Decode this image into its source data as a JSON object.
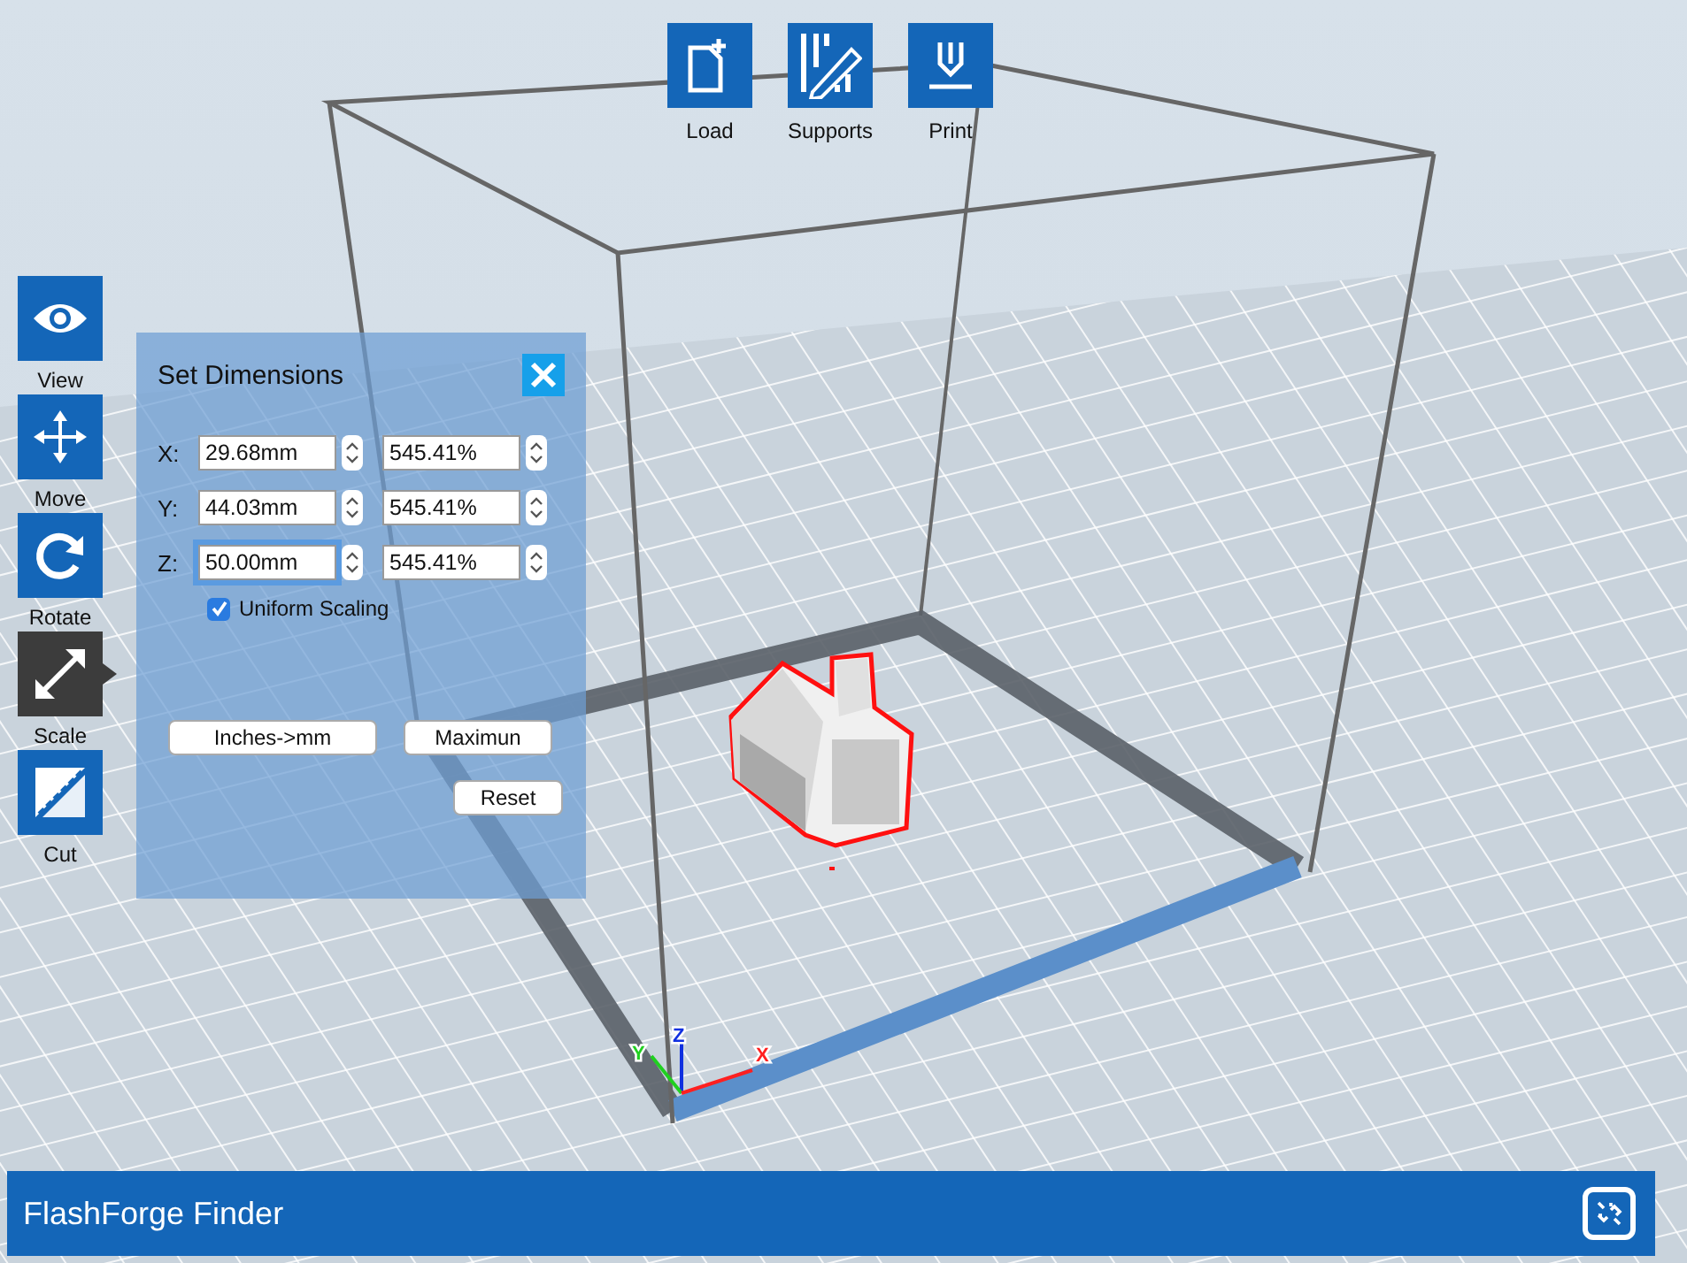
{
  "top_toolbar": [
    {
      "label": "Load",
      "kind": "load"
    },
    {
      "label": "Supports",
      "kind": "supports"
    },
    {
      "label": "Print",
      "kind": "print"
    }
  ],
  "side_toolbar": [
    {
      "label": "View",
      "kind": "view",
      "selected": false
    },
    {
      "label": "Move",
      "kind": "move",
      "selected": false
    },
    {
      "label": "Rotate",
      "kind": "rotate",
      "selected": false
    },
    {
      "label": "Scale",
      "kind": "scale",
      "selected": true
    },
    {
      "label": "Cut",
      "kind": "cut",
      "selected": false
    }
  ],
  "dimensions_panel": {
    "title": "Set Dimensions",
    "rows": [
      {
        "axis": "X:",
        "size": "29.68mm",
        "percent": "545.41%",
        "focused": false
      },
      {
        "axis": "Y:",
        "size": "44.03mm",
        "percent": "545.41%",
        "focused": false
      },
      {
        "axis": "Z:",
        "size": "50.00mm",
        "percent": "545.41%",
        "focused": true
      }
    ],
    "uniform_scaling": {
      "label": "Uniform Scaling",
      "checked": true
    },
    "buttons": [
      "Inches->mm",
      "Maximun"
    ],
    "reset": "Reset"
  },
  "scene": {
    "axes": [
      {
        "label": "Z",
        "color": "#1030e0"
      },
      {
        "label": "Y",
        "color": "#20d020"
      },
      {
        "label": "X",
        "color": "#ff2020"
      }
    ]
  },
  "status_bar": {
    "title": "FlashForge Finder"
  }
}
